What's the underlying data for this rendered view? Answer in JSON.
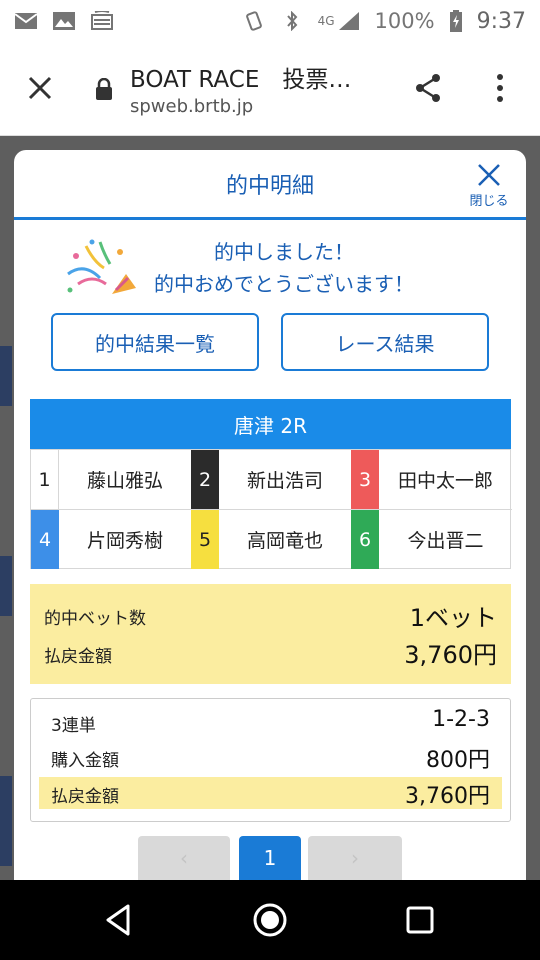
{
  "status_bar": {
    "network": "4G",
    "battery": "100%",
    "time": "9:37"
  },
  "browser": {
    "title": "BOAT RACE　投票…",
    "url": "spweb.brtb.jp"
  },
  "modal": {
    "title": "的中明細",
    "close_label": "閉じる",
    "congrats_line1": "的中しました！",
    "congrats_line2": "的中おめでとうございます！",
    "buttons": {
      "hit_list": "的中結果一覧",
      "race_result": "レース結果"
    },
    "race": {
      "name": "唐津 2R",
      "racers": [
        {
          "num": "1",
          "name": "藤山雅弘",
          "color": "#ffffff",
          "text_color": "#222222"
        },
        {
          "num": "2",
          "name": "新出浩司",
          "color": "#2b2b2b",
          "text_color": "#ffffff"
        },
        {
          "num": "3",
          "name": "田中太一郎",
          "color": "#ee5a5a",
          "text_color": "#ffffff"
        },
        {
          "num": "4",
          "name": "片岡秀樹",
          "color": "#3d8fe8",
          "text_color": "#ffffff"
        },
        {
          "num": "5",
          "name": "高岡竜也",
          "color": "#f6df3f",
          "text_color": "#222222"
        },
        {
          "num": "6",
          "name": "今出晋二",
          "color": "#2faa57",
          "text_color": "#ffffff"
        }
      ]
    },
    "summary": {
      "bets_label": "的中ベット数",
      "bets_value": "1ベット",
      "payout_label": "払戻金額",
      "payout_value": "3,760円"
    },
    "detail": {
      "type_label": "3連単",
      "type_value": "1-2-3",
      "purchase_label": "購入金額",
      "purchase_value": "800円",
      "payout_label": "払戻金額",
      "payout_value": "3,760円"
    },
    "pager": {
      "prev": "‹",
      "current": "1",
      "next": "›"
    }
  },
  "colors": {
    "accent": "#1a7bd6",
    "highlight": "#fbeda0",
    "race_header": "#1a8be8"
  }
}
